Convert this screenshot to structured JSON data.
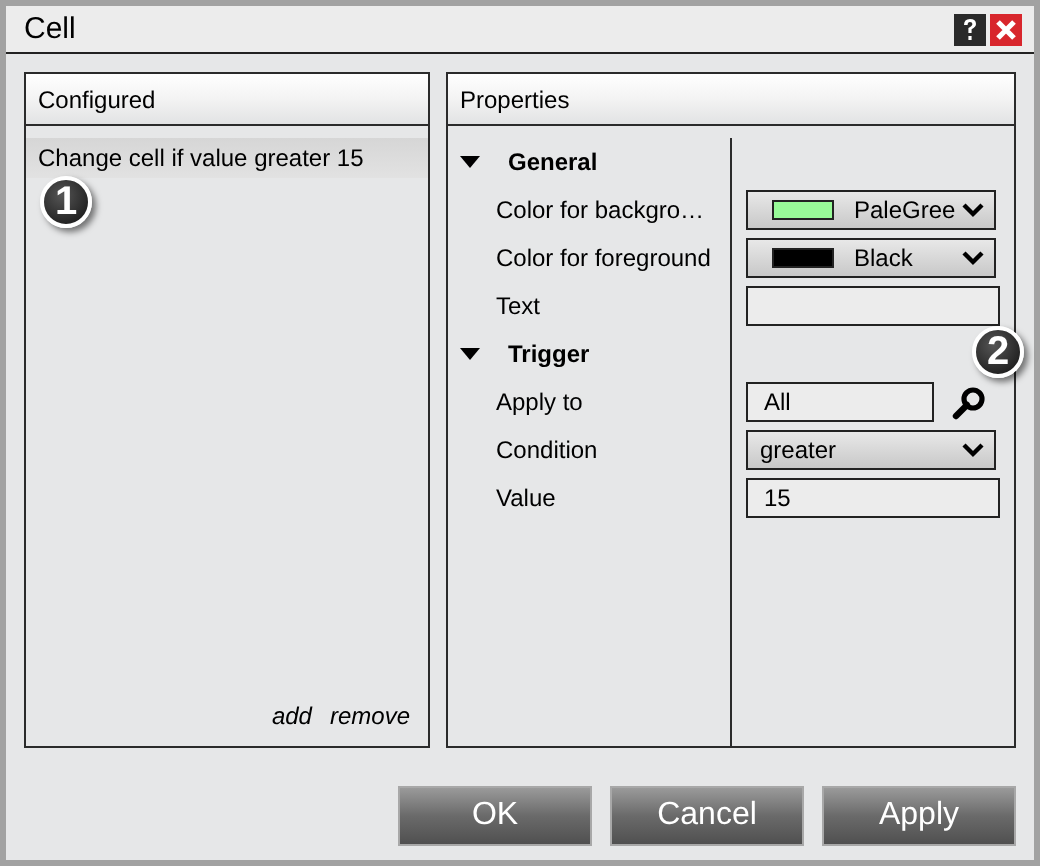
{
  "window": {
    "title": "Cell"
  },
  "configured": {
    "header": "Configured",
    "items": [
      {
        "label": "Change cell if value greater 15",
        "selected": true
      }
    ],
    "links": [
      "add",
      "remove"
    ]
  },
  "properties": {
    "header": "Properties",
    "groups": [
      {
        "label": "General",
        "expanded": true,
        "rows": [
          {
            "label": "Color for backgro…",
            "kind": "color",
            "value": "PaleGree",
            "color": "#98fb98"
          },
          {
            "label": "Color for foreground",
            "kind": "color",
            "value": "Black",
            "color": "#000000"
          },
          {
            "label": "Text",
            "kind": "field"
          }
        ]
      },
      {
        "label": "Trigger",
        "expanded": true,
        "rows": [
          {
            "label": "Apply to",
            "kind": "lookup",
            "value": "All"
          },
          {
            "label": "Condition",
            "kind": "select",
            "value": "greater"
          },
          {
            "label": "Value",
            "kind": "field",
            "value": "15"
          }
        ]
      }
    ]
  },
  "buttons": [
    "OK",
    "Cancel",
    "Apply"
  ],
  "callouts": [
    "1",
    "2"
  ]
}
